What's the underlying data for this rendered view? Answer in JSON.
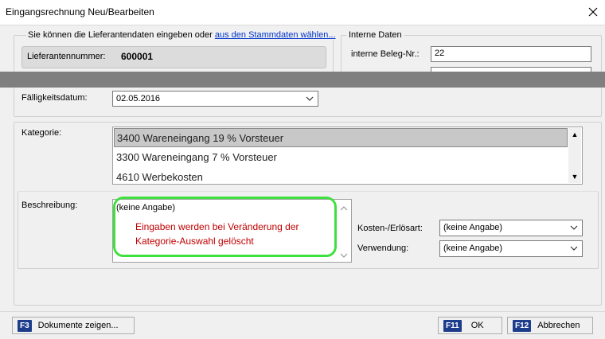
{
  "window": {
    "title": "Eingangsrechnung Neu/Bearbeiten"
  },
  "supplier": {
    "intro_text": "Sie können die Lieferantendaten eingeben oder",
    "link_text": "aus den Stammdaten wählen...",
    "number_label": "Lieferantennummer:",
    "number_value": "600001"
  },
  "internal": {
    "group_title": "Interne Daten",
    "beleg_label": "interne Beleg-Nr.:",
    "beleg_value": "22"
  },
  "due_date": {
    "label": "Fälligkeitsdatum:",
    "value": "02.05.2016"
  },
  "category": {
    "label": "Kategorie:",
    "items": [
      "3400 Wareneingang 19 % Vorsteuer",
      "3300 Wareneingang 7 % Vorsteuer",
      "4610 Werbekosten"
    ],
    "selected_index": 0
  },
  "description": {
    "label": "Beschreibung:",
    "value": "(keine Angabe)",
    "hint_line1": "Eingaben werden bei Veränderung der",
    "hint_line2": "Kategorie-Auswahl gelöscht"
  },
  "cost_type": {
    "label": "Kosten-/Erlösart:",
    "value": "(keine Angabe)"
  },
  "usage": {
    "label": "Verwendung:",
    "value": "(keine Angabe)"
  },
  "buttons": {
    "documents": {
      "key": "F3",
      "label": "Dokumente zeigen..."
    },
    "ok": {
      "key": "F11",
      "label": "OK"
    },
    "cancel": {
      "key": "F12",
      "label": "Abbrechen"
    }
  },
  "colors": {
    "hint_border": "#3ee03e",
    "hint_text": "#c00000",
    "fkey_bg": "#1e3c8c",
    "overlay": "#7f7f7f"
  }
}
